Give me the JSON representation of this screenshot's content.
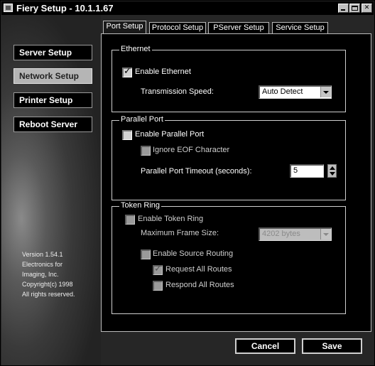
{
  "window": {
    "title": "Fiery Setup - 10.1.1.67"
  },
  "sidebar": {
    "items": [
      {
        "label": "Server Setup"
      },
      {
        "label": "Network Setup",
        "active": true
      },
      {
        "label": "Printer Setup"
      },
      {
        "label": "Reboot Server"
      }
    ],
    "version_lines": [
      "Version 1.54.1",
      "Electronics for",
      "Imaging, Inc.",
      "Copyright(c) 1998",
      "All rights reserved."
    ]
  },
  "tabs": [
    {
      "label": "Port Setup",
      "active": true
    },
    {
      "label": "Protocol Setup"
    },
    {
      "label": "PServer Setup"
    },
    {
      "label": "Service Setup"
    }
  ],
  "ethernet": {
    "legend": "Ethernet",
    "enable_label": "Enable Ethernet",
    "enable_checked": true,
    "speed_label": "Transmission Speed:",
    "speed_value": "Auto Detect"
  },
  "parallel": {
    "legend": "Parallel Port",
    "enable_label": "Enable Parallel Port",
    "enable_checked": false,
    "ignore_eof_label": "Ignore EOF Character",
    "ignore_eof_checked": false,
    "timeout_label": "Parallel Port Timeout (seconds):",
    "timeout_value": "5"
  },
  "token_ring": {
    "legend": "Token Ring",
    "enable_label": "Enable Token Ring",
    "enable_checked": false,
    "frame_size_label": "Maximum Frame Size:",
    "frame_size_value": "4202 bytes",
    "source_routing_label": "Enable Source Routing",
    "source_routing_checked": false,
    "request_routes_label": "Request All Routes",
    "request_routes_checked": true,
    "respond_routes_label": "Respond All Routes",
    "respond_routes_checked": false
  },
  "footer": {
    "cancel_label": "Cancel",
    "save_label": "Save"
  },
  "icons": {
    "app": "window-icon",
    "minimize": "minimize-icon",
    "maximize": "maximize-icon",
    "close": "close-icon",
    "dropdown": "chevron-down-icon",
    "spin_up": "spin-up-icon",
    "spin_down": "spin-down-icon",
    "check": "check-icon"
  },
  "colors": {
    "panel_bg": "#000000",
    "window_bg": "#262626",
    "active_nav": "#b5b5b5",
    "text": "#ffffff"
  }
}
